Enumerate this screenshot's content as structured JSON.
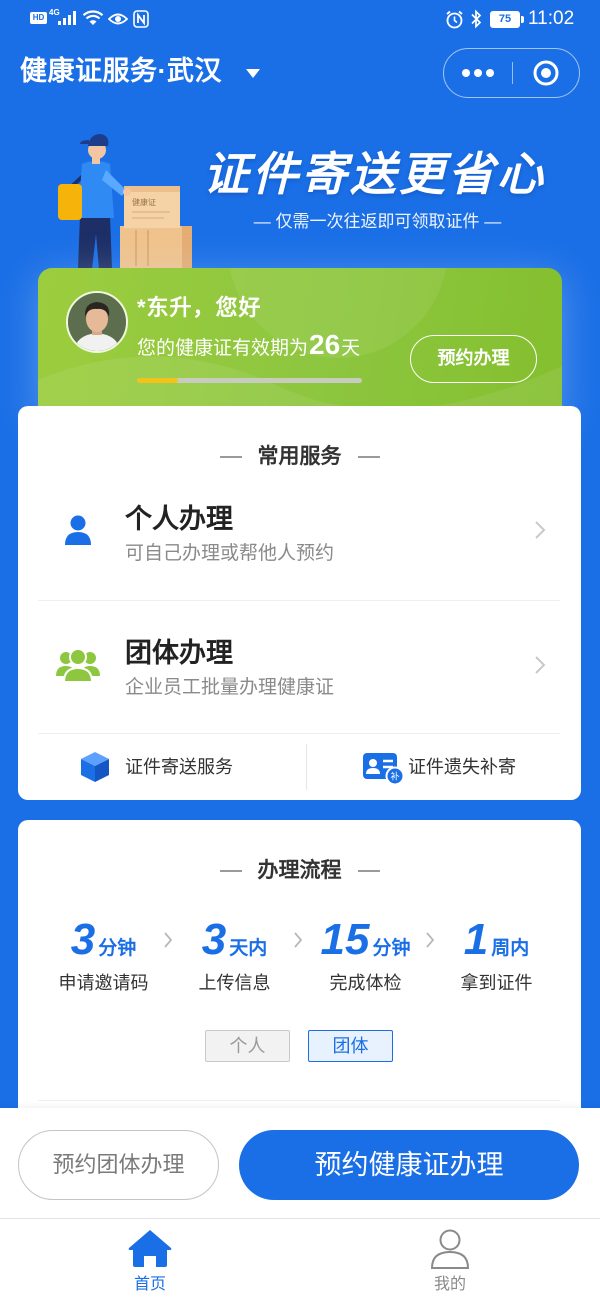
{
  "status_bar": {
    "hd": "HD",
    "network": "4G",
    "battery": "75",
    "time": "11:02",
    "left_icons": [
      "hd-icon",
      "signal-icon",
      "wifi-icon",
      "eye-icon",
      "nfc-icon"
    ],
    "right_icons": [
      "alarm-icon",
      "bluetooth-icon",
      "battery-icon"
    ]
  },
  "header": {
    "title": "健康证服务·武汉",
    "title_icon": "chevron-down-icon",
    "capsule_icons": [
      "more-icon",
      "target-icon"
    ]
  },
  "banner": {
    "headline": "证件寄送更省心",
    "subline": "— 仅需一次往返即可领取证件 —",
    "box_label": "健康证"
  },
  "user_card": {
    "greeting": "*东升，您好",
    "validity_prefix": "您的健康证有效期为",
    "validity_days": "26",
    "validity_suffix": "天",
    "validity_progress": 0.18,
    "button": "预约办理"
  },
  "services": {
    "title": "常用服务",
    "items": [
      {
        "name": "个人办理",
        "desc": "可自己办理或帮他人预约",
        "icon": "person-icon"
      },
      {
        "name": "团体办理",
        "desc": "企业员工批量办理健康证",
        "icon": "group-icon"
      }
    ],
    "links": [
      {
        "label": "证件寄送服务",
        "icon": "box-icon"
      },
      {
        "label": "证件遗失补寄",
        "icon": "id-card-reissue-icon",
        "badge": "补"
      }
    ]
  },
  "process": {
    "title": "办理流程",
    "steps": [
      {
        "num": "3",
        "unit": "分钟",
        "label": "申请邀请码"
      },
      {
        "num": "3",
        "unit": "天内",
        "label": "上传信息"
      },
      {
        "num": "15",
        "unit": "分钟",
        "label": "完成体检"
      },
      {
        "num": "1",
        "unit": "周内",
        "label": "拿到证件"
      }
    ],
    "toggles": [
      {
        "label": "个人",
        "active": false
      },
      {
        "label": "团体",
        "active": true
      }
    ]
  },
  "actions": {
    "secondary": "预约团体办理",
    "primary": "预约健康证办理"
  },
  "tabbar": [
    {
      "label": "首页",
      "icon": "home-icon",
      "active": true
    },
    {
      "label": "我的",
      "icon": "profile-icon",
      "active": false
    }
  ],
  "colors": {
    "primary": "#1b6fe6",
    "green_card": "#8dc63f",
    "progress_fill": "#f5c21b",
    "text_dark": "#222222",
    "text_muted": "#8a8a8a"
  }
}
